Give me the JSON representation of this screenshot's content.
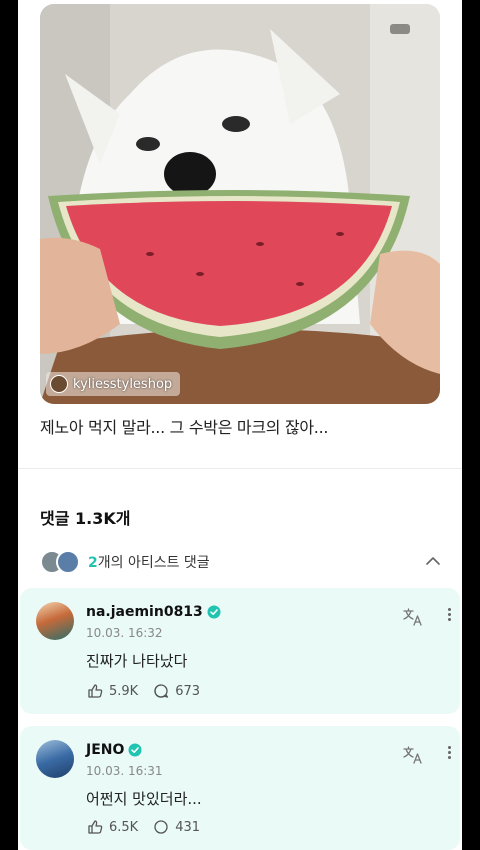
{
  "post": {
    "source_handle": "kyliesstyleshop",
    "caption": "제노아 먹지 말라... 그 수박은 마크의 잖아..."
  },
  "comments_section": {
    "count_label": "댓글 1.3K개",
    "artist_count": "2",
    "artist_label_suffix": "개의 아티스트 댓글"
  },
  "comments": [
    {
      "username": "na.jaemin0813",
      "timestamp": "10.03. 16:32",
      "text": "진짜가 나타났다",
      "likes": "5.9K",
      "replies": "673"
    },
    {
      "username": "JENO",
      "timestamp": "10.03. 16:31",
      "text": "어쩐지 맛있더라...",
      "likes": "6.5K",
      "replies": "431"
    }
  ],
  "colors": {
    "accent": "#20c4b0",
    "card_bg": "#e9faf7",
    "verified": "#20c4b0"
  },
  "icons": [
    "chevron-up-icon",
    "verified-badge-icon",
    "translate-icon",
    "more-vertical-icon",
    "like-icon",
    "reply-icon"
  ]
}
